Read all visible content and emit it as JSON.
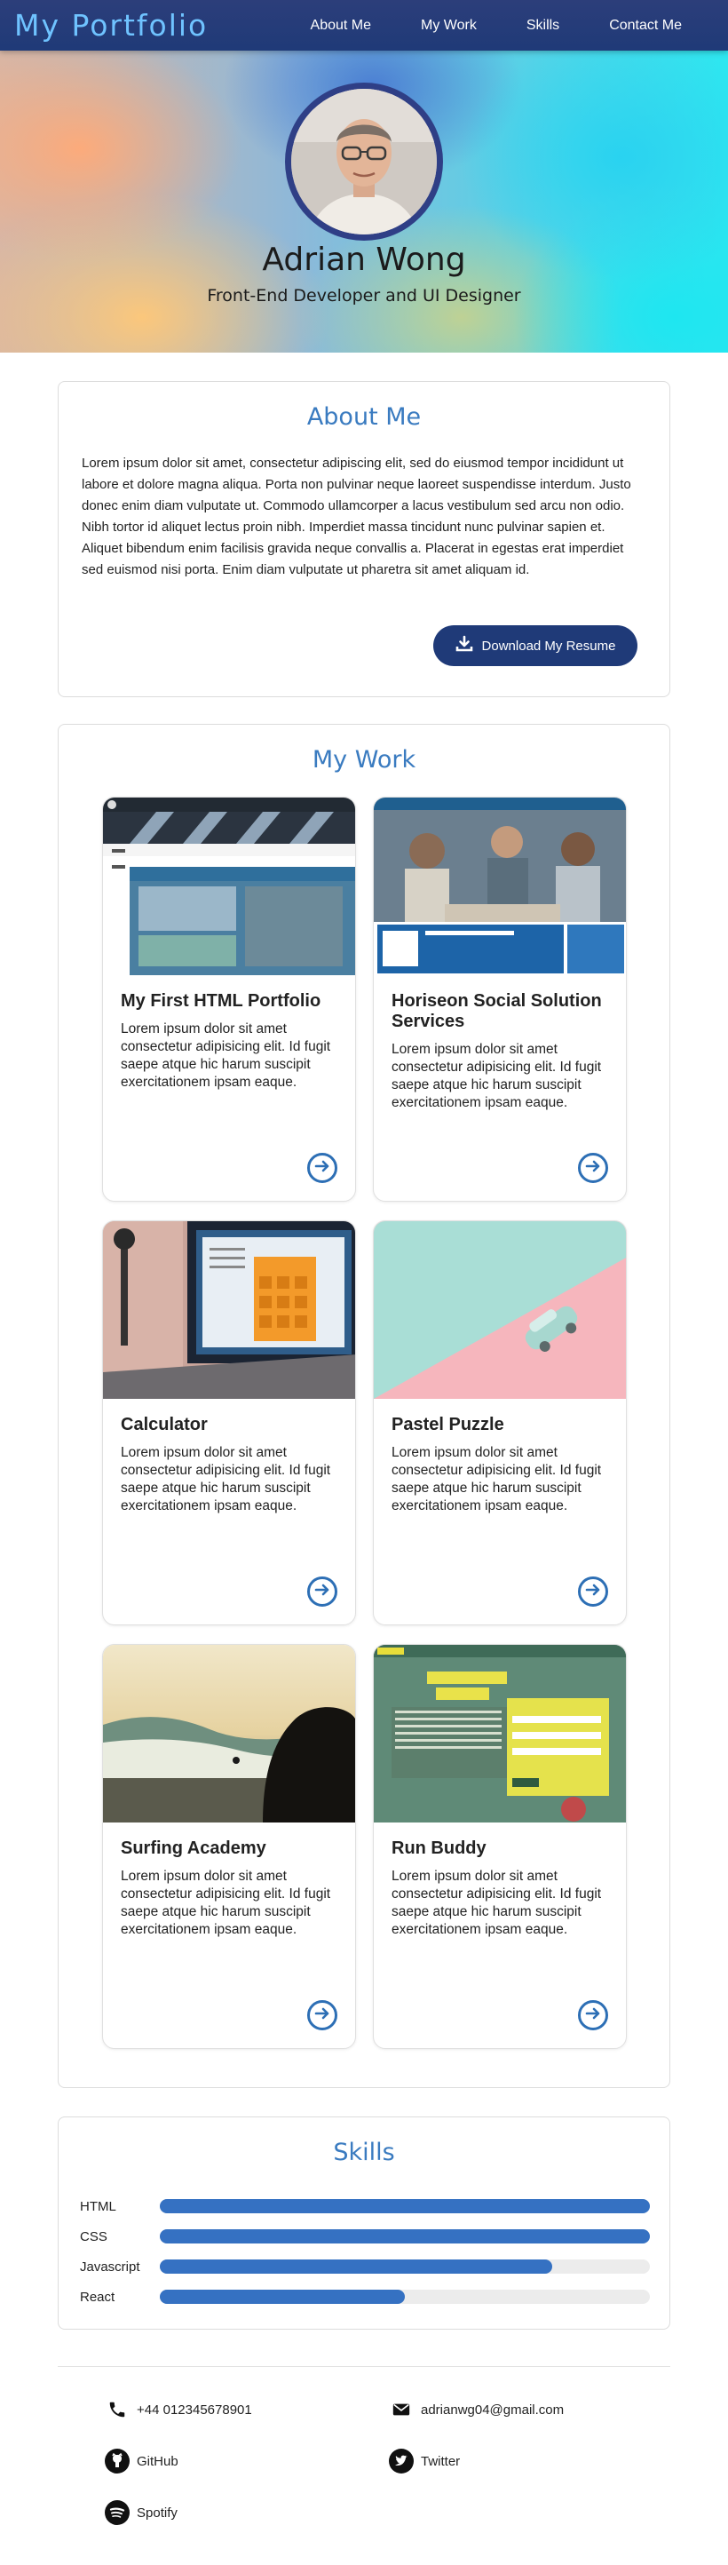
{
  "nav": {
    "brand": "My Portfolio",
    "links": [
      "About Me",
      "My Work",
      "Skills",
      "Contact Me"
    ]
  },
  "hero": {
    "name": "Adrian Wong",
    "role": "Front-End Developer and UI Designer"
  },
  "about": {
    "title": "About Me",
    "paragraph1": "Lorem ipsum dolor sit amet, consectetur adipiscing elit, sed do eiusmod tempor incididunt ut labore et dolore magna aliqua. Porta non pulvinar neque laoreet suspendisse interdum. Justo donec enim diam vulputate ut. Commodo ullamcorper a lacus vestibulum sed arcu non odio.",
    "paragraph2": "Nibh tortor id aliquet lectus proin nibh. Imperdiet massa tincidunt nunc pulvinar sapien et. Aliquet bibendum enim facilisis gravida neque convallis a. Placerat in egestas erat imperdiet sed euismod nisi porta. Enim diam vulputate ut pharetra sit amet aliquam id.",
    "resume_label": "Download My Resume"
  },
  "work": {
    "title": "My Work",
    "projects": [
      {
        "title": "My First HTML Portfolio",
        "desc": "Lorem ipsum dolor sit amet consectetur adipisicing elit. Id fugit saepe atque hic harum suscipit exercitationem ipsam eaque."
      },
      {
        "title": "Horiseon Social Solution Services",
        "desc": "Lorem ipsum dolor sit amet consectetur adipisicing elit. Id fugit saepe atque hic harum suscipit exercitationem ipsam eaque."
      },
      {
        "title": "Calculator",
        "desc": "Lorem ipsum dolor sit amet consectetur adipisicing elit. Id fugit saepe atque hic harum suscipit exercitationem ipsam eaque."
      },
      {
        "title": "Pastel Puzzle",
        "desc": "Lorem ipsum dolor sit amet consectetur adipisicing elit. Id fugit saepe atque hic harum suscipit exercitationem ipsam eaque."
      },
      {
        "title": "Surfing Academy",
        "desc": "Lorem ipsum dolor sit amet consectetur adipisicing elit. Id fugit saepe atque hic harum suscipit exercitationem ipsam eaque."
      },
      {
        "title": "Run Buddy",
        "desc": "Lorem ipsum dolor sit amet consectetur adipisicing elit. Id fugit saepe atque hic harum suscipit exercitationem ipsam eaque."
      }
    ]
  },
  "skills": {
    "title": "Skills",
    "items": [
      {
        "name": "HTML",
        "level": 1.0
      },
      {
        "name": "CSS",
        "level": 1.0
      },
      {
        "name": "Javascript",
        "level": 0.8
      },
      {
        "name": "React",
        "level": 0.5
      }
    ]
  },
  "contact": {
    "phone": "+44 012345678901",
    "email": "adrianwg04@gmail.com",
    "github": "GitHub",
    "twitter": "Twitter",
    "spotify": "Spotify"
  },
  "colors": {
    "navbar": "#1f3a78",
    "brand": "#6fc3ff",
    "accent": "#3a7bc0",
    "skill_fill": "#3571c2"
  },
  "icons": [
    "download-icon",
    "arrow-right-circle-icon",
    "phone-icon",
    "envelope-icon",
    "github-icon",
    "twitter-icon",
    "spotify-icon"
  ]
}
